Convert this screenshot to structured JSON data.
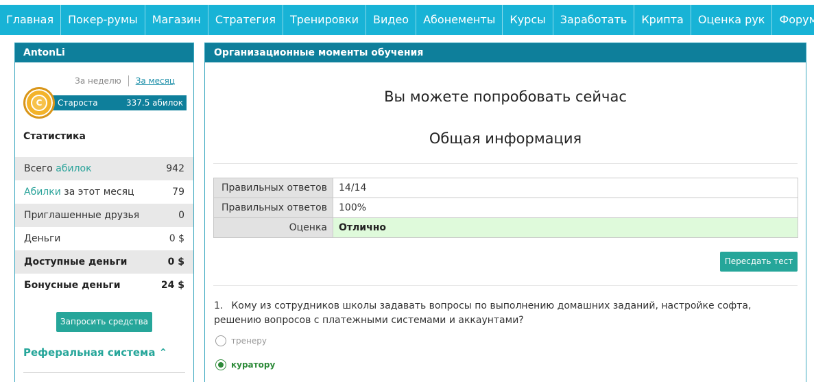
{
  "nav": {
    "items": [
      {
        "label": "Главная"
      },
      {
        "label": "Покер-румы"
      },
      {
        "label": "Магазин"
      },
      {
        "label": "Стратегия"
      },
      {
        "label": "Тренировки"
      },
      {
        "label": "Видео"
      },
      {
        "label": "Абонементы"
      },
      {
        "label": "Курсы"
      },
      {
        "label": "Заработать"
      },
      {
        "label": "Крипта"
      },
      {
        "label": "Оценка рук"
      },
      {
        "label": "Форум"
      }
    ]
  },
  "sidebar": {
    "username": "AntonLi",
    "period_week": "За неделю",
    "period_month": "За месяц",
    "chip_letter": "C",
    "rank_label": "Староста",
    "rank_points": "337.5 абилок",
    "stats_title": "Статистика",
    "stats": {
      "total_prefix": "Всего ",
      "total_accent": "абилок",
      "total_value": "942",
      "month_accent": "Абилки",
      "month_suffix": " за этот месяц",
      "month_value": "79",
      "friends_label": "Приглашенные друзья",
      "friends_value": "0",
      "money_label": "Деньги",
      "money_value": "0 $",
      "available_label": "Доступные деньги",
      "available_value": "0 $",
      "bonus_label": "Бонусные деньги",
      "bonus_value": "24 $"
    },
    "request_button": "Запросить средства",
    "referral_label": "Реферальная система ⌃"
  },
  "main": {
    "title": "Организационные моменты обучения",
    "try_now": "Вы можете попробовать сейчас",
    "general_info": "Общая информация",
    "results": [
      {
        "label": "Правильных ответов",
        "value": "14/14"
      },
      {
        "label": "Правильных ответов",
        "value": "100%"
      },
      {
        "label": "Оценка",
        "value": "Отлично"
      }
    ],
    "retake_button": "Пересдать тест",
    "question": {
      "number": "1.",
      "text": "Кому из сотрудников школы задавать вопросы по выполнению домашних заданий, настройке софта, решению вопросов с платежными системами и аккаунтами?",
      "options": [
        {
          "label": "тренеру",
          "checked": false
        },
        {
          "label": "куратору",
          "checked": true
        }
      ]
    }
  },
  "colors": {
    "nav_bg": "#18b3d6",
    "panel_header": "#0e7f9b",
    "accent_green": "#26a69a",
    "success_bg": "#dffadb"
  }
}
